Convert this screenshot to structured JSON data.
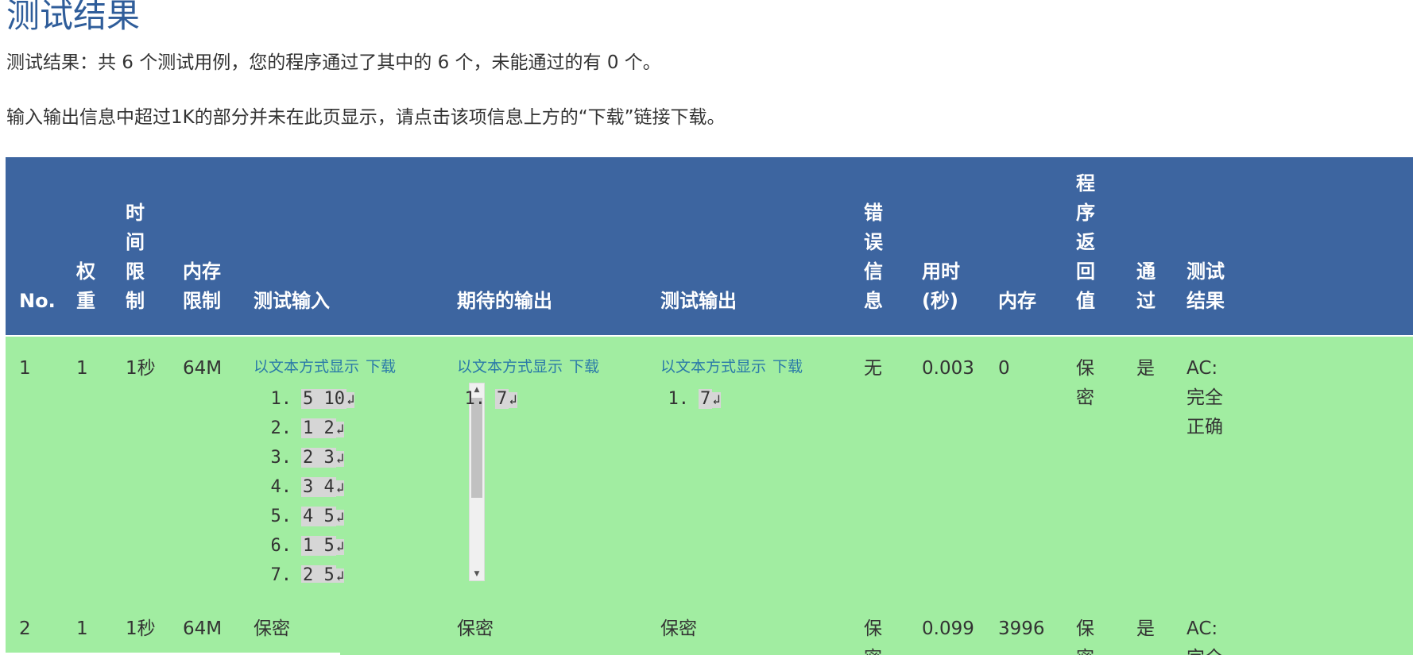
{
  "page": {
    "title": "测试结果",
    "summary": "测试结果：共 6 个测试用例，您的程序通过了其中的 6 个，未能通过的有 0 个。",
    "note": "输入输出信息中超过1K的部分并未在此页显示，请点击该项信息上方的“下载”链接下载。"
  },
  "table": {
    "headers": {
      "no": "No.",
      "weight": "权\n重",
      "time_limit": "时\n间\n限\n制",
      "mem_limit": "内存\n限制",
      "input": "测试输入",
      "expected": "期待的输出",
      "output": "测试输出",
      "error": "错\n误\n信\n息",
      "time_used": "用时\n(秒)",
      "memory": "内存",
      "return_value": "程\n序\n返\n回\n值",
      "passed": "通\n过",
      "result": "测试\n结果"
    },
    "links": {
      "show_text": "以文本方式显示",
      "download": "下载"
    },
    "return_glyph": "↲",
    "rows": [
      {
        "no": "1",
        "weight": "1",
        "time_limit": "1秒",
        "mem_limit": "64M",
        "input_lines": [
          {
            "n": "1.",
            "text": "5 10"
          },
          {
            "n": "2.",
            "text": "1 2"
          },
          {
            "n": "3.",
            "text": "2 3"
          },
          {
            "n": "4.",
            "text": "3 4"
          },
          {
            "n": "5.",
            "text": "4 5"
          },
          {
            "n": "6.",
            "text": "1 5"
          },
          {
            "n": "7.",
            "text": "2 5"
          }
        ],
        "expected_lines": [
          {
            "n": "1.",
            "text": "7"
          }
        ],
        "output_lines": [
          {
            "n": "1.",
            "text": "7"
          }
        ],
        "error": "无",
        "time_used": "0.003",
        "memory": "0",
        "return_value": "保\n密",
        "passed": "是",
        "result": "AC:\n完全\n正确"
      },
      {
        "no": "2",
        "weight": "1",
        "time_limit": "1秒",
        "mem_limit": "64M",
        "input": "保密",
        "expected": "保密",
        "output": "保密",
        "error": "保\n密",
        "time_used": "0.099",
        "memory": "3996",
        "return_value": "保\n密",
        "passed": "是",
        "result": "AC:\n完全"
      }
    ]
  }
}
